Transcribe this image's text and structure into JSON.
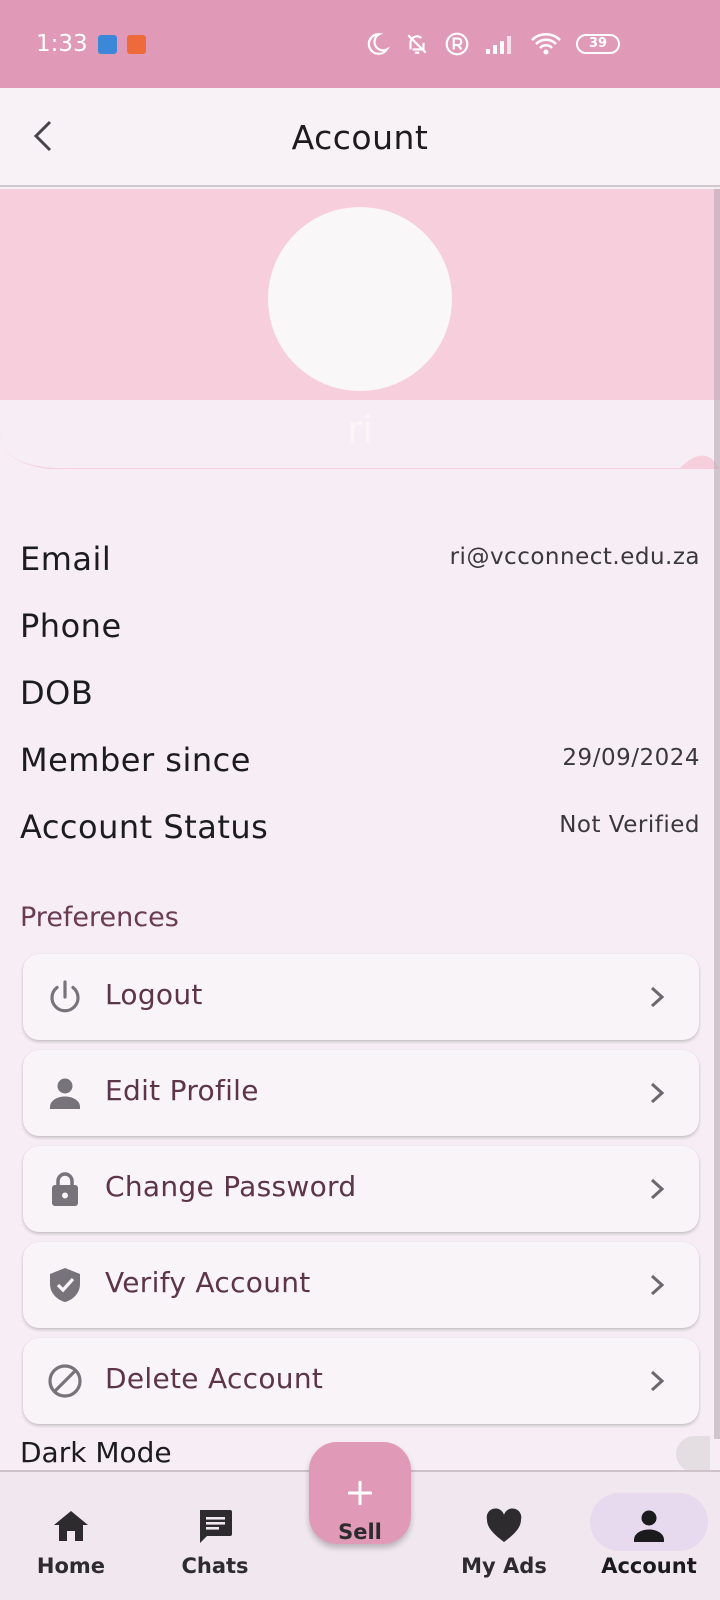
{
  "status_bar": {
    "time": "1:33",
    "battery": "39"
  },
  "app_bar": {
    "title": "Account"
  },
  "profile": {
    "name": "ri"
  },
  "info": {
    "email_label": "Email",
    "email_value": "ri@vcconnect.edu.za",
    "phone_label": "Phone",
    "dob_label": "DOB",
    "member_since_label": "Member since",
    "member_since_value": "29/09/2024",
    "status_label": "Account Status",
    "status_value": "Not Verified"
  },
  "preferences": {
    "title": "Preferences",
    "items": [
      {
        "label": "Logout",
        "icon": "power-icon"
      },
      {
        "label": "Edit Profile",
        "icon": "person-icon"
      },
      {
        "label": "Change Password",
        "icon": "lock-icon"
      },
      {
        "label": "Verify Account",
        "icon": "shield-check-icon"
      },
      {
        "label": "Delete Account",
        "icon": "block-icon"
      }
    ],
    "dark_mode_label": "Dark Mode"
  },
  "bottom_nav": {
    "items": [
      {
        "label": "Home",
        "icon": "home-icon"
      },
      {
        "label": "Chats",
        "icon": "chat-icon"
      },
      {
        "label": "Sell",
        "icon": "plus-icon"
      },
      {
        "label": "My Ads",
        "icon": "heart-icon"
      },
      {
        "label": "Account",
        "icon": "person-icon",
        "active": true
      }
    ]
  },
  "colors": {
    "status_bar": "#e09ab8",
    "header": "#f7cfdc",
    "accent_text": "#5d3448",
    "fab": "#e09ab8",
    "active_pill": "#e7d9ee"
  }
}
